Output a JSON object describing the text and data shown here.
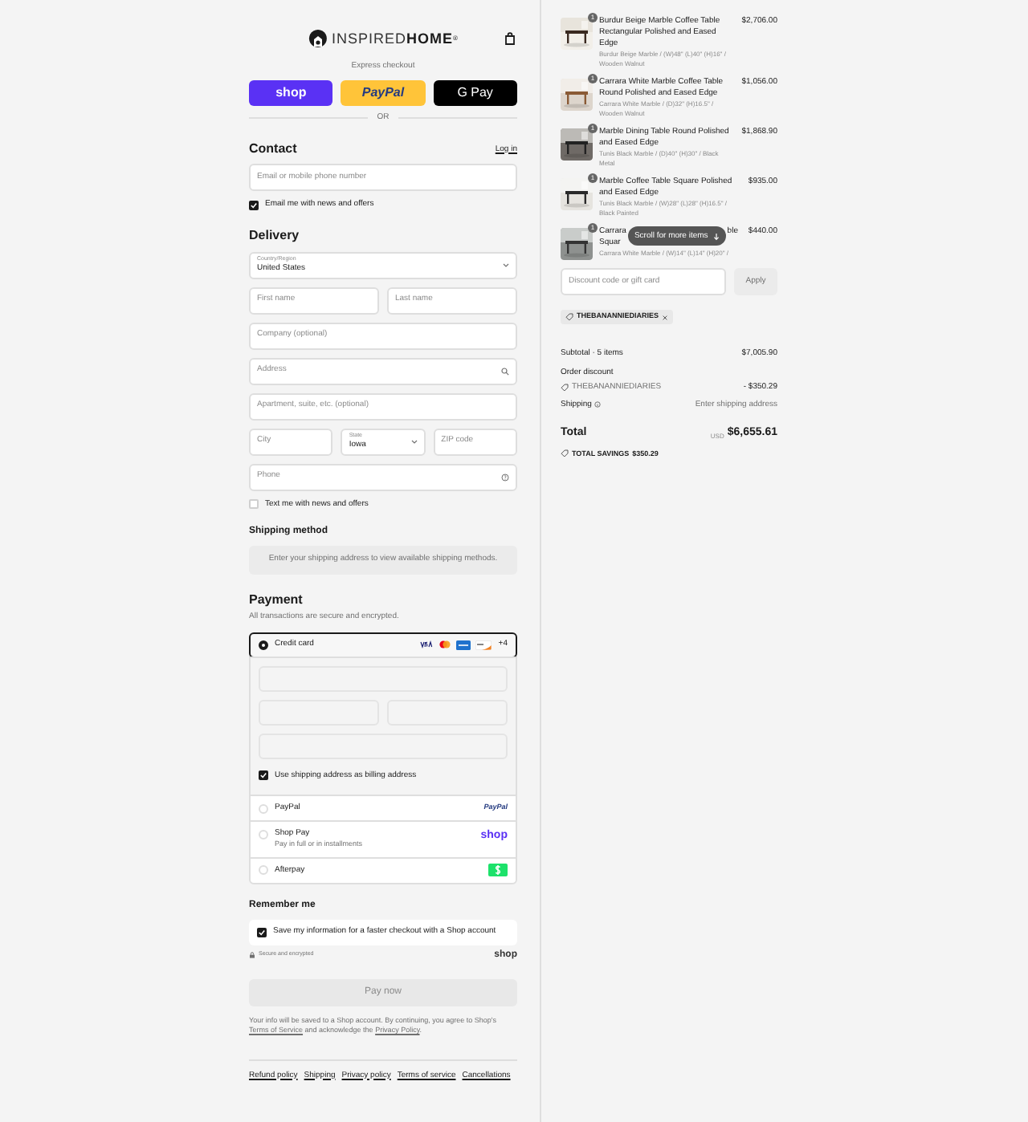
{
  "header": {
    "logo_light": "INSPIRED",
    "logo_bold": "HOME",
    "logo_mark": "®"
  },
  "express": {
    "title": "Express checkout",
    "buttons": [
      {
        "kind": "shop",
        "label": "shop"
      },
      {
        "kind": "paypal",
        "label": "PayPal"
      },
      {
        "kind": "gpay",
        "label": "G Pay"
      }
    ],
    "divider": "OR"
  },
  "contact": {
    "heading": "Contact",
    "login": "Log in",
    "email_placeholder": "Email or mobile phone number",
    "news": {
      "label": "Email me with news and offers",
      "checked": true
    }
  },
  "delivery": {
    "heading": "Delivery",
    "rows": [
      [
        {
          "kind": "select",
          "label": "Country/Region",
          "value": "United States"
        }
      ],
      [
        {
          "kind": "text",
          "placeholder": "First name"
        },
        {
          "kind": "text",
          "placeholder": "Last name"
        }
      ],
      [
        {
          "kind": "text",
          "placeholder": "Company (optional)"
        }
      ],
      [
        {
          "kind": "address",
          "placeholder": "Address"
        }
      ],
      [
        {
          "kind": "text",
          "placeholder": "Apartment, suite, etc. (optional)"
        }
      ],
      [
        {
          "kind": "text",
          "placeholder": "City"
        },
        {
          "kind": "select",
          "label": "State",
          "value": "Iowa"
        },
        {
          "kind": "text",
          "placeholder": "ZIP code"
        }
      ],
      [
        {
          "kind": "phone",
          "placeholder": "Phone"
        }
      ]
    ],
    "sms": {
      "label": "Text me with news and offers",
      "checked": false
    }
  },
  "shipping_method": {
    "heading": "Shipping method",
    "notice": "Enter your shipping address to view available shipping methods."
  },
  "payment": {
    "heading": "Payment",
    "subtitle": "All transactions are secure and encrypted.",
    "more_brands": "+4",
    "billing": {
      "label": "Use shipping address as billing address",
      "checked": true
    },
    "methods": [
      {
        "kind": "card",
        "label": "Credit card",
        "selected": true
      },
      {
        "kind": "paypal",
        "label": "PayPal",
        "logo": "PayPal",
        "selected": false
      },
      {
        "kind": "shoppay",
        "label": "Shop Pay",
        "sublabel": "Pay in full or in installments",
        "logo": "shop",
        "selected": false
      },
      {
        "kind": "afterpay",
        "label": "Afterpay",
        "selected": false
      }
    ]
  },
  "remember": {
    "heading": "Remember me",
    "label": "Save my information for a faster checkout with a Shop account",
    "checked": true,
    "secure": "Secure and encrypted",
    "shop_logo": "shop"
  },
  "pay_button": "Pay now",
  "disclaimer": [
    {
      "kind": "text",
      "text": "Your info will be saved to a Shop account. By continuing, you agree to Shop's "
    },
    {
      "kind": "link",
      "text": "Terms of Service"
    },
    {
      "kind": "text",
      "text": " and acknowledge the "
    },
    {
      "kind": "link",
      "text": "Privacy Policy"
    },
    {
      "kind": "text",
      "text": "."
    }
  ],
  "footer_links": [
    "Refund policy",
    "Shipping",
    "Privacy policy",
    "Terms of service",
    "Cancellations"
  ],
  "summary": {
    "items": [
      {
        "qty": "1",
        "name": "Burdur Beige Marble Coffee Table Rectangular Polished and Eased Edge",
        "variant": "Burdur Beige Marble / (W)48\" (L)40\" (H)16\" / Wooden Walnut",
        "price": "$2,706.00"
      },
      {
        "qty": "1",
        "name": "Carrara White Marble Coffee Table Round Polished and Eased Edge",
        "variant": "Carrara White Marble / (D)32\" (H)16.5\" / Wooden Walnut",
        "price": "$1,056.00"
      },
      {
        "qty": "1",
        "name": "Marble Dining Table Round Polished and Eased Edge",
        "variant": "Tunis Black Marble / (D)40\" (H)30\" / Black Metal",
        "price": "$1,868.90"
      },
      {
        "qty": "1",
        "name": "Marble Coffee Table Square Polished and Eased Edge",
        "variant": "Tunis Black Marble / (W)28\" (L)28\" (H)16.5\" / Black Painted",
        "price": "$935.00"
      },
      {
        "qty": "1",
        "kind": "covered",
        "name_parts": [
          "Carrara",
          "ble",
          "Squar"
        ],
        "variant": "Carrara White Marble / (W)14\" (L)14\" (H)20\" /",
        "price": "$440.00"
      }
    ],
    "scroll_hint": "Scroll for more items",
    "discount_placeholder": "Discount code or gift card",
    "apply": "Apply",
    "applied_code": "THEBANANNIEDIARIES",
    "subtotal_label": "Subtotal · 5 items",
    "subtotal": "$7,005.90",
    "discount_label": "Order discount",
    "discount_code": "THEBANANNIEDIARIES",
    "discount": "- $350.29",
    "shipping_label": "Shipping",
    "shipping": "Enter shipping address",
    "total_label": "Total",
    "currency": "USD",
    "total": "$6,655.61",
    "savings_label": "TOTAL SAVINGS",
    "savings": "$350.29"
  }
}
